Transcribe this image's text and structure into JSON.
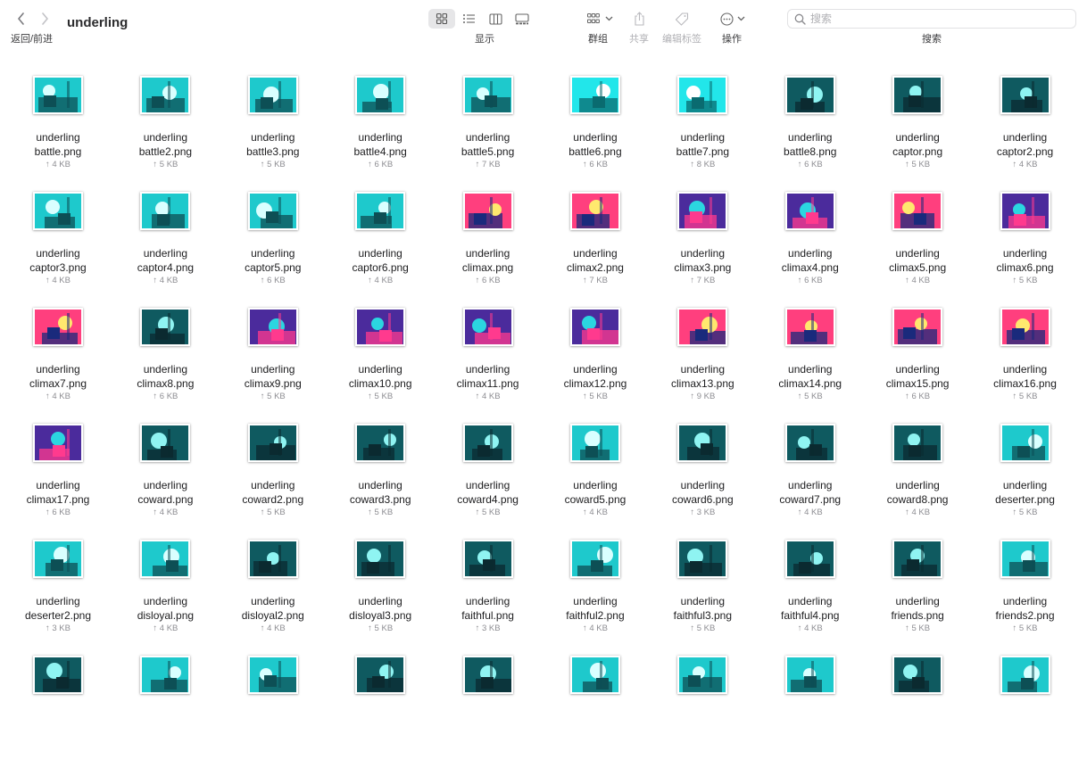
{
  "toolbar": {
    "title": "underling",
    "nav_label": "返回/前进",
    "view_label": "显示",
    "group_label": "群组",
    "share_label": "共享",
    "tags_label": "编辑标签",
    "action_label": "操作",
    "search_label": "搜索",
    "search_placeholder": "搜索"
  },
  "files": [
    {
      "line1": "underling",
      "line2": "battle.png",
      "size": "↑ 4 KB",
      "palette": "teal"
    },
    {
      "line1": "underling",
      "line2": "battle2.png",
      "size": "↑ 5 KB",
      "palette": "teal"
    },
    {
      "line1": "underling",
      "line2": "battle3.png",
      "size": "↑ 5 KB",
      "palette": "teal"
    },
    {
      "line1": "underling",
      "line2": "battle4.png",
      "size": "↑ 6 KB",
      "palette": "teal"
    },
    {
      "line1": "underling",
      "line2": "battle5.png",
      "size": "↑ 7 KB",
      "palette": "teal"
    },
    {
      "line1": "underling",
      "line2": "battle6.png",
      "size": "↑ 6 KB",
      "palette": "cyan"
    },
    {
      "line1": "underling",
      "line2": "battle7.png",
      "size": "↑ 8 KB",
      "palette": "cyan"
    },
    {
      "line1": "underling",
      "line2": "battle8.png",
      "size": "↑ 6 KB",
      "palette": "dark"
    },
    {
      "line1": "underling",
      "line2": "captor.png",
      "size": "↑ 5 KB",
      "palette": "dark"
    },
    {
      "line1": "underling",
      "line2": "captor2.png",
      "size": "↑ 4 KB",
      "palette": "dark"
    },
    {
      "line1": "underling",
      "line2": "captor3.png",
      "size": "↑ 4 KB",
      "palette": "teal"
    },
    {
      "line1": "underling",
      "line2": "captor4.png",
      "size": "↑ 4 KB",
      "palette": "teal"
    },
    {
      "line1": "underling",
      "line2": "captor5.png",
      "size": "↑ 6 KB",
      "palette": "teal"
    },
    {
      "line1": "underling",
      "line2": "captor6.png",
      "size": "↑ 4 KB",
      "palette": "teal"
    },
    {
      "line1": "underling",
      "line2": "climax.png",
      "size": "↑ 6 KB",
      "palette": "vivid"
    },
    {
      "line1": "underling",
      "line2": "climax2.png",
      "size": "↑ 7 KB",
      "palette": "vivid"
    },
    {
      "line1": "underling",
      "line2": "climax3.png",
      "size": "↑ 7 KB",
      "palette": "purple"
    },
    {
      "line1": "underling",
      "line2": "climax4.png",
      "size": "↑ 6 KB",
      "palette": "purple"
    },
    {
      "line1": "underling",
      "line2": "climax5.png",
      "size": "↑ 4 KB",
      "palette": "vivid"
    },
    {
      "line1": "underling",
      "line2": "climax6.png",
      "size": "↑ 5 KB",
      "palette": "purple"
    },
    {
      "line1": "underling",
      "line2": "climax7.png",
      "size": "↑ 4 KB",
      "palette": "vivid"
    },
    {
      "line1": "underling",
      "line2": "climax8.png",
      "size": "↑ 6 KB",
      "palette": "dark"
    },
    {
      "line1": "underling",
      "line2": "climax9.png",
      "size": "↑ 5 KB",
      "palette": "purple"
    },
    {
      "line1": "underling",
      "line2": "climax10.png",
      "size": "↑ 5 KB",
      "palette": "purple"
    },
    {
      "line1": "underling",
      "line2": "climax11.png",
      "size": "↑ 4 KB",
      "palette": "purple"
    },
    {
      "line1": "underling",
      "line2": "climax12.png",
      "size": "↑ 5 KB",
      "palette": "purple"
    },
    {
      "line1": "underling",
      "line2": "climax13.png",
      "size": "↑ 9 KB",
      "palette": "vivid"
    },
    {
      "line1": "underling",
      "line2": "climax14.png",
      "size": "↑ 5 KB",
      "palette": "vivid"
    },
    {
      "line1": "underling",
      "line2": "climax15.png",
      "size": "↑ 6 KB",
      "palette": "vivid"
    },
    {
      "line1": "underling",
      "line2": "climax16.png",
      "size": "↑ 5 KB",
      "palette": "vivid"
    },
    {
      "line1": "underling",
      "line2": "climax17.png",
      "size": "↑ 6 KB",
      "palette": "purple"
    },
    {
      "line1": "underling",
      "line2": "coward.png",
      "size": "↑ 4 KB",
      "palette": "dark"
    },
    {
      "line1": "underling",
      "line2": "coward2.png",
      "size": "↑ 5 KB",
      "palette": "dark"
    },
    {
      "line1": "underling",
      "line2": "coward3.png",
      "size": "↑ 5 KB",
      "palette": "dark"
    },
    {
      "line1": "underling",
      "line2": "coward4.png",
      "size": "↑ 5 KB",
      "palette": "dark"
    },
    {
      "line1": "underling",
      "line2": "coward5.png",
      "size": "↑ 4 KB",
      "palette": "teal"
    },
    {
      "line1": "underling",
      "line2": "coward6.png",
      "size": "↑ 3 KB",
      "palette": "dark"
    },
    {
      "line1": "underling",
      "line2": "coward7.png",
      "size": "↑ 4 KB",
      "palette": "dark"
    },
    {
      "line1": "underling",
      "line2": "coward8.png",
      "size": "↑ 4 KB",
      "palette": "dark"
    },
    {
      "line1": "underling",
      "line2": "deserter.png",
      "size": "↑ 5 KB",
      "palette": "teal"
    },
    {
      "line1": "underling",
      "line2": "deserter2.png",
      "size": "↑ 3 KB",
      "palette": "teal"
    },
    {
      "line1": "underling",
      "line2": "disloyal.png",
      "size": "↑ 4 KB",
      "palette": "teal"
    },
    {
      "line1": "underling",
      "line2": "disloyal2.png",
      "size": "↑ 4 KB",
      "palette": "dark"
    },
    {
      "line1": "underling",
      "line2": "disloyal3.png",
      "size": "↑ 5 KB",
      "palette": "dark"
    },
    {
      "line1": "underling",
      "line2": "faithful.png",
      "size": "↑ 3 KB",
      "palette": "dark"
    },
    {
      "line1": "underling",
      "line2": "faithful2.png",
      "size": "↑ 4 KB",
      "palette": "teal"
    },
    {
      "line1": "underling",
      "line2": "faithful3.png",
      "size": "↑ 5 KB",
      "palette": "dark"
    },
    {
      "line1": "underling",
      "line2": "faithful4.png",
      "size": "↑ 4 KB",
      "palette": "dark"
    },
    {
      "line1": "underling",
      "line2": "friends.png",
      "size": "↑ 5 KB",
      "palette": "dark"
    },
    {
      "line1": "underling",
      "line2": "friends2.png",
      "size": "↑ 5 KB",
      "palette": "teal"
    },
    {
      "line1": "",
      "line2": "",
      "size": "",
      "palette": "dark"
    },
    {
      "line1": "",
      "line2": "",
      "size": "",
      "palette": "teal"
    },
    {
      "line1": "",
      "line2": "",
      "size": "",
      "palette": "teal"
    },
    {
      "line1": "",
      "line2": "",
      "size": "",
      "palette": "dark"
    },
    {
      "line1": "",
      "line2": "",
      "size": "",
      "palette": "dark"
    },
    {
      "line1": "",
      "line2": "",
      "size": "",
      "palette": "teal"
    },
    {
      "line1": "",
      "line2": "",
      "size": "",
      "palette": "teal"
    },
    {
      "line1": "",
      "line2": "",
      "size": "",
      "palette": "teal"
    },
    {
      "line1": "",
      "line2": "",
      "size": "",
      "palette": "dark"
    },
    {
      "line1": "",
      "line2": "",
      "size": "",
      "palette": "teal"
    }
  ],
  "colors": {
    "accent": "#0a84ff",
    "palettes": {
      "teal": [
        "#1ec9cc",
        "#0d4f55",
        "#d9ffff"
      ],
      "cyan": [
        "#22e6ea",
        "#0a6b70",
        "#ffffff"
      ],
      "dark": [
        "#0f5a60",
        "#0b2a30",
        "#8ff4f2"
      ],
      "vivid": [
        "#ff3f7e",
        "#1a2a7c",
        "#ffe86e"
      ],
      "purple": [
        "#4b2b9c",
        "#ff3a8e",
        "#2bd6e0"
      ]
    }
  }
}
